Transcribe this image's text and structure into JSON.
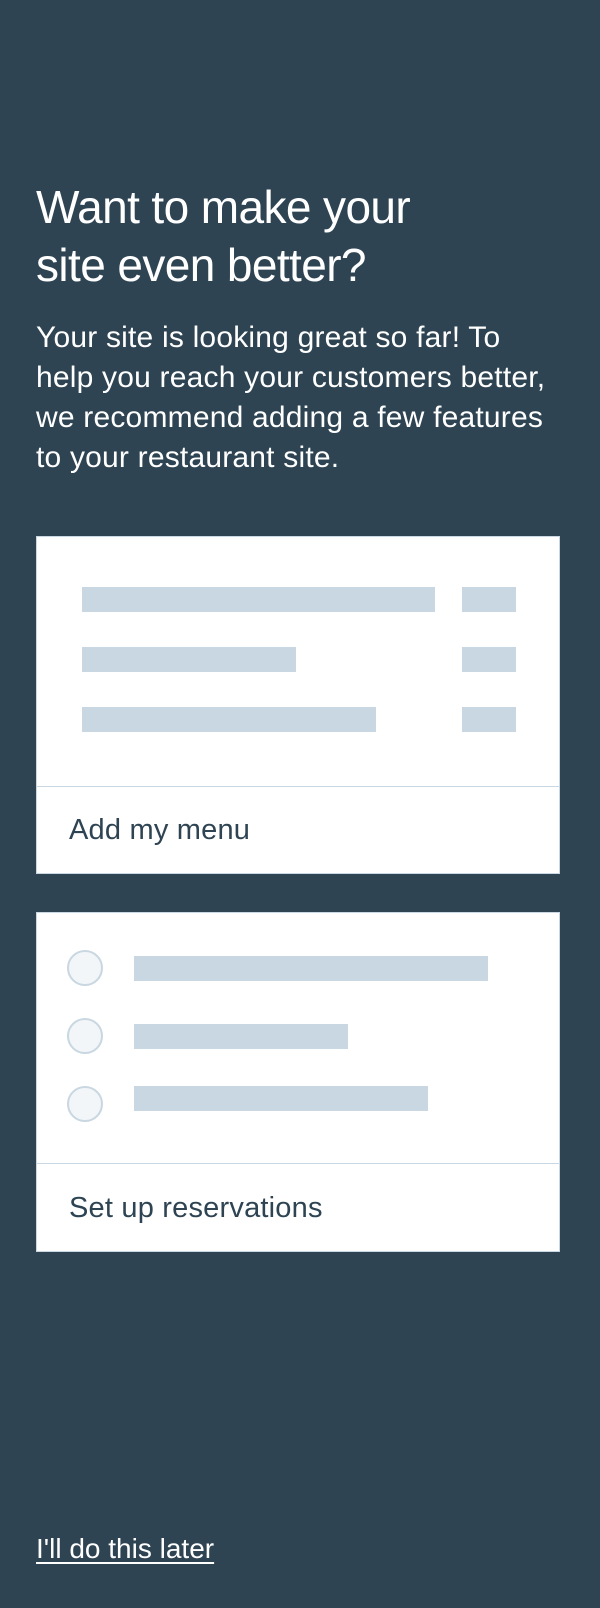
{
  "header": {
    "title": "Want to make your site even better?",
    "description": "Your site is looking great so far! To help you reach your customers better, we recommend adding a few features to your restaurant site."
  },
  "cards": [
    {
      "label": "Add my menu",
      "preview_icon": "menu-list-illustration"
    },
    {
      "label": "Set up reservations",
      "preview_icon": "reservation-options-illustration"
    }
  ],
  "footer": {
    "skip_label": "I'll do this later"
  },
  "colors": {
    "background": "#2e4453",
    "card": "#ffffff",
    "placeholder": "#c8d7e1",
    "label_text": "#2e4453"
  }
}
